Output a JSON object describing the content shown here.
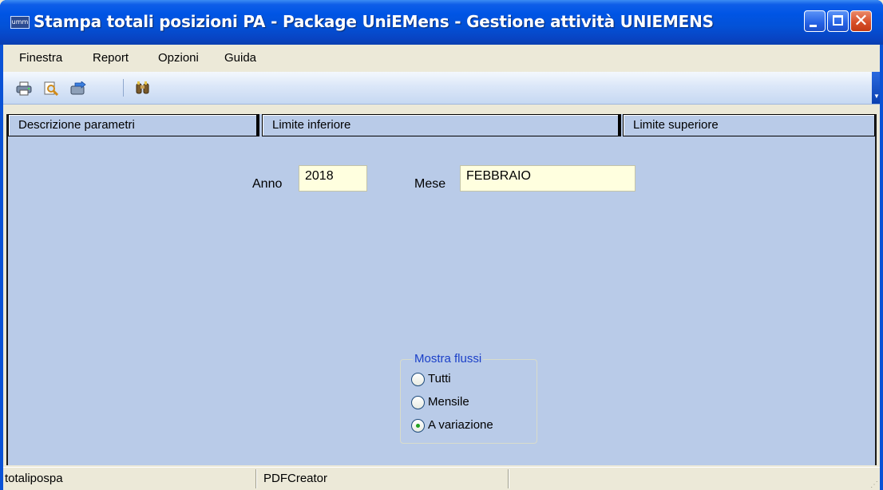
{
  "window": {
    "title": "Stampa totali posizioni PA - Package UniEMens - Gestione attività UNIEMENS",
    "icon_text": "umm",
    "controls": [
      "minimize",
      "maximize",
      "close"
    ]
  },
  "menu": {
    "items": [
      {
        "label": "Finestra"
      },
      {
        "label": "Report"
      },
      {
        "label": "Opzioni"
      },
      {
        "label": "Guida"
      }
    ]
  },
  "toolbar": {
    "icons": [
      "print-icon",
      "print-preview-icon",
      "export-icon",
      "run-query-icon"
    ]
  },
  "parameters": {
    "columns": [
      "Descrizione parametri",
      "Limite inferiore",
      "Limite superiore"
    ],
    "anno_label": "Anno",
    "anno_value": "2018",
    "mese_label": "Mese",
    "mese_value": "FEBBRAIO"
  },
  "mostra_flussi": {
    "title": "Mostra flussi",
    "options": [
      {
        "label": "Tutti",
        "selected": false
      },
      {
        "label": "Mensile",
        "selected": false
      },
      {
        "label": "A variazione",
        "selected": true
      }
    ]
  },
  "statusbar": {
    "panes": [
      "totalipospa",
      "PDFCreator",
      ""
    ]
  },
  "colors": {
    "panel_background": "#b9cbe8",
    "field_background": "#ffffdf",
    "group_title": "#1a3fc8",
    "titlebar": "#0055e5"
  }
}
